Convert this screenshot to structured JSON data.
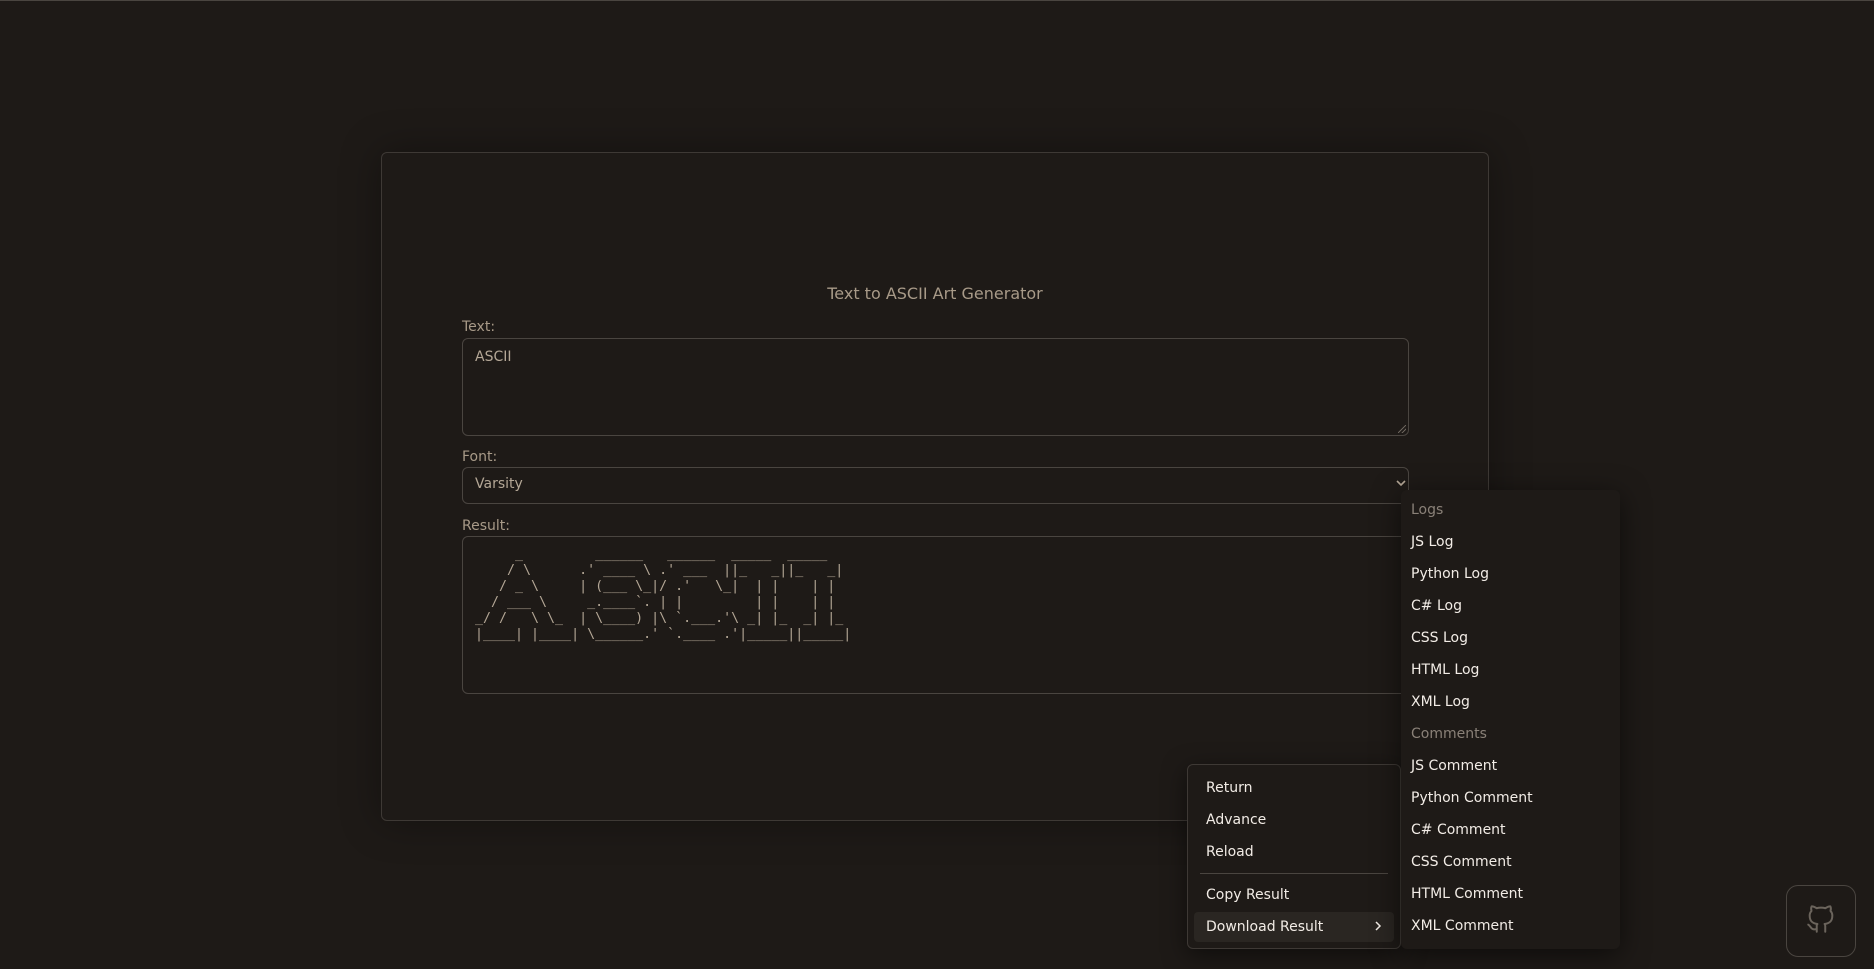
{
  "app": {
    "title": "Text to ASCII Art Generator"
  },
  "form": {
    "text_label": "Text:",
    "text_value": "ASCII",
    "font_label": "Font:",
    "font_value": "Varsity",
    "result_label": "Result:",
    "result_ascii": "     _         ______   ______  _____  _____  \n    / \\      .' ____ \\ .' ___  ||_   _||_   _| \n   / _ \\     | (___ \\_|/ .'   \\_|  | |    | |   \n  / ___ \\     _.____`. | |         | |    | |   \n_/ /   \\ \\_  | \\____) |\\ `.___.'\\ _| |_  _| |_  \n|____| |____| \\______.' `.____ .'|_____||_____| "
  },
  "context_menu": {
    "items": [
      {
        "label": "Return"
      },
      {
        "label": "Advance"
      },
      {
        "label": "Reload"
      },
      {
        "label": "Copy Result"
      },
      {
        "label": "Download Result"
      }
    ]
  },
  "download_submenu": {
    "logs_heading": "Logs",
    "logs": [
      "JS Log",
      "Python Log",
      "C# Log",
      "CSS Log",
      "HTML Log",
      "XML Log"
    ],
    "comments_heading": "Comments",
    "comments": [
      "JS Comment",
      "Python Comment",
      "C# Comment",
      "CSS Comment",
      "HTML Comment",
      "XML Comment"
    ]
  },
  "icons": {
    "github": "github-icon",
    "select_chevron": "chevron-down-icon",
    "submenu_chevron": "chevron-right-icon"
  }
}
